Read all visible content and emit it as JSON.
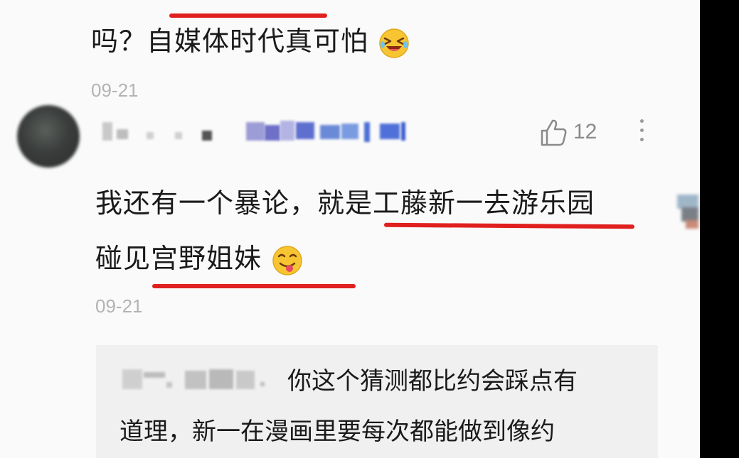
{
  "comment_prev": {
    "text_line": "吗？自媒体时代真可怕",
    "emoji_icon": "laughing-tears-face-icon",
    "date": "09-21"
  },
  "comment_main": {
    "like_count": "12",
    "line1": "我还有一个暴论，就是工藤新一去游乐园",
    "line2": "碰见宫野姐妹",
    "emoji_icon": "yummy-tongue-face-icon",
    "date": "09-21"
  },
  "reply": {
    "line1": "你这个猜测都比约会踩点有",
    "line2": "道理，新一在漫画里要每次都能做到像约"
  },
  "colors": {
    "annotation_red": "#e0201f",
    "background": "#fafafa",
    "date_gray": "#b3b3b3"
  }
}
